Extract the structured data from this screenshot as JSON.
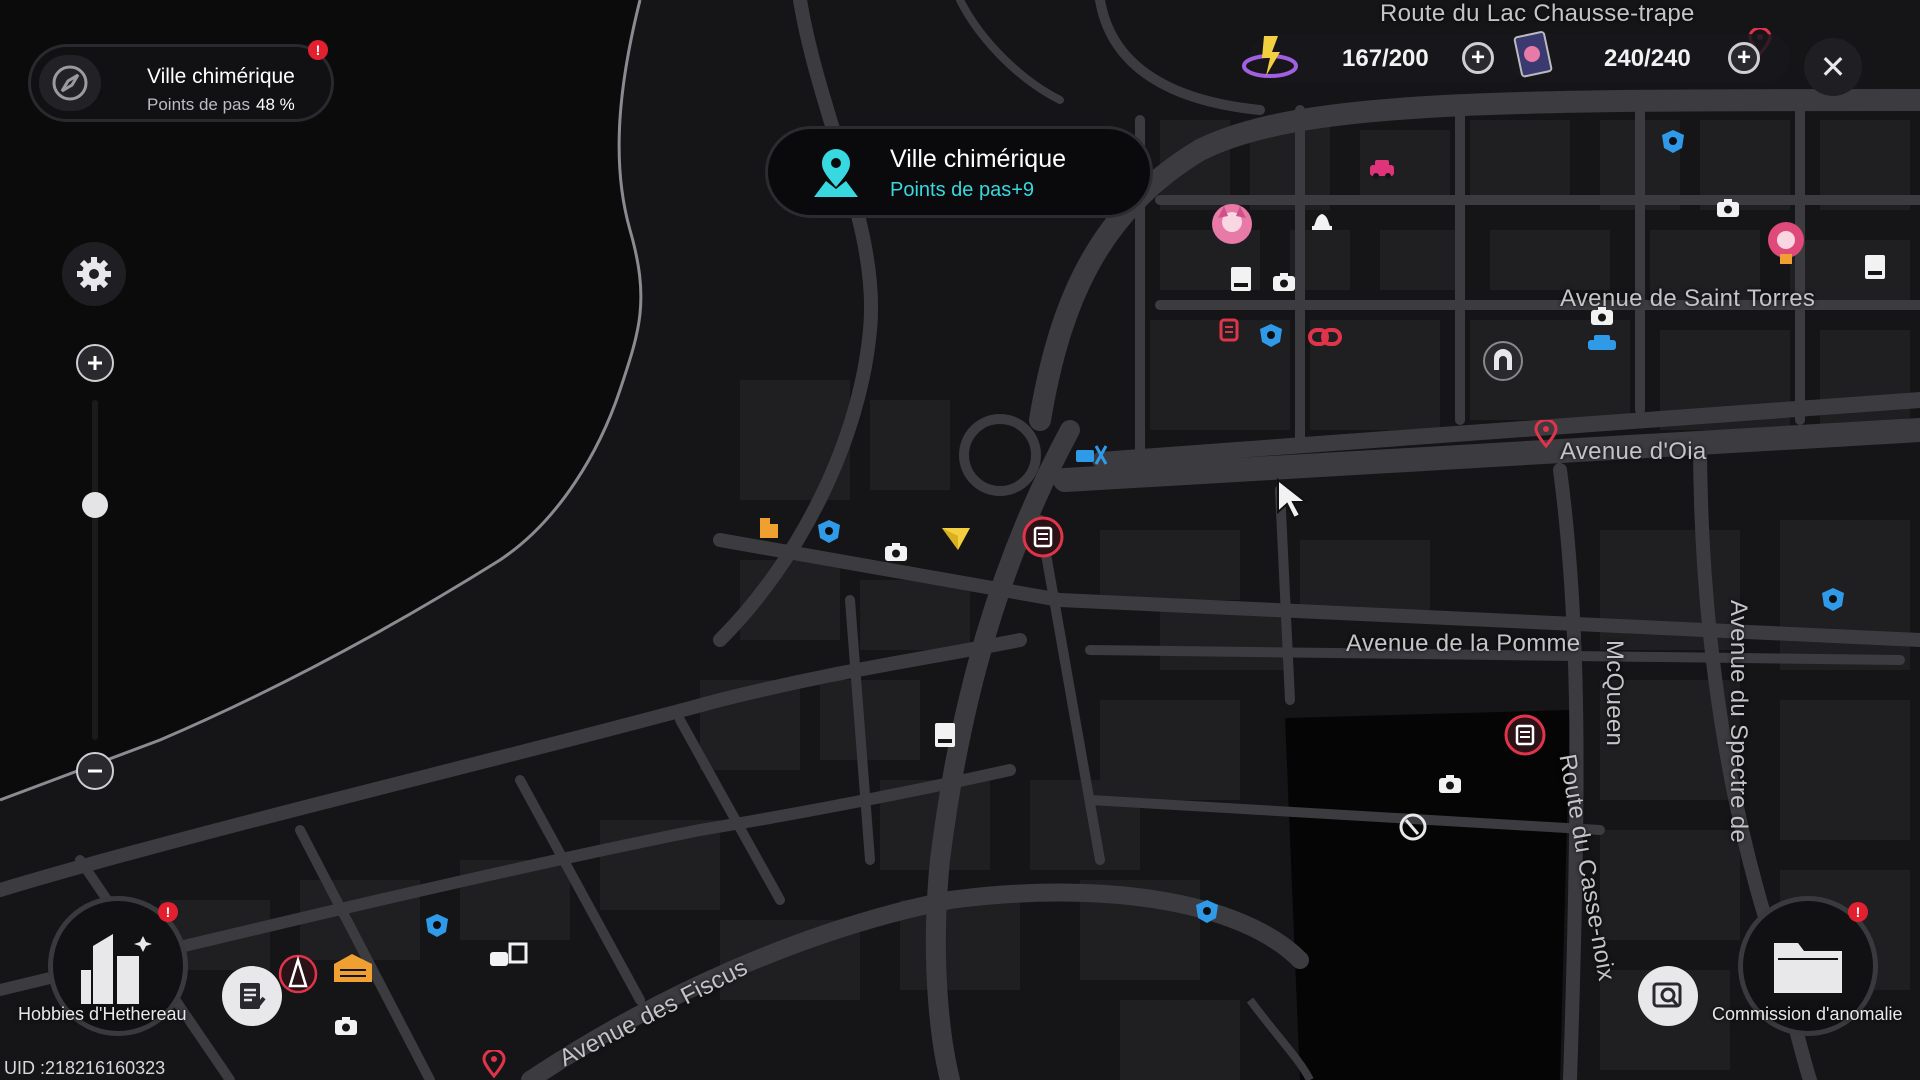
{
  "location_pill": {
    "name": "Ville chimérique",
    "progress_label": "Points de pas",
    "progress_value": "48 %"
  },
  "banner": {
    "title": "Ville chimérique",
    "subtitle": "Points de pas+9"
  },
  "resources": {
    "energy": "167/200",
    "tickets": "240/240"
  },
  "streets": {
    "lac": "Route du Lac Chausse-trape",
    "saint_torres": "Avenue de Saint Torres",
    "oia": "Avenue d'Oia",
    "pomme": "Avenue de la Pomme",
    "mcqueen": "McQueen",
    "spectre": "Avenue du Spectre de",
    "casse_noix": "Route du Casse-noix",
    "fiscus": "Avenue des Fiscus"
  },
  "bottom": {
    "hobbies_label": "Hobbies d'Hethereau",
    "commission_label": "Commission d'anomalie",
    "uid": "UID :218216160323"
  },
  "colors": {
    "cyan_accent": "#38d8e0",
    "alert_red": "#e32030",
    "road": "#3a3a3e",
    "block": "#1e1e21",
    "water": "#0b0b0c",
    "poi_blue": "#2f9ae8",
    "poi_red": "#e0344a",
    "poi_orange": "#f0a030"
  }
}
